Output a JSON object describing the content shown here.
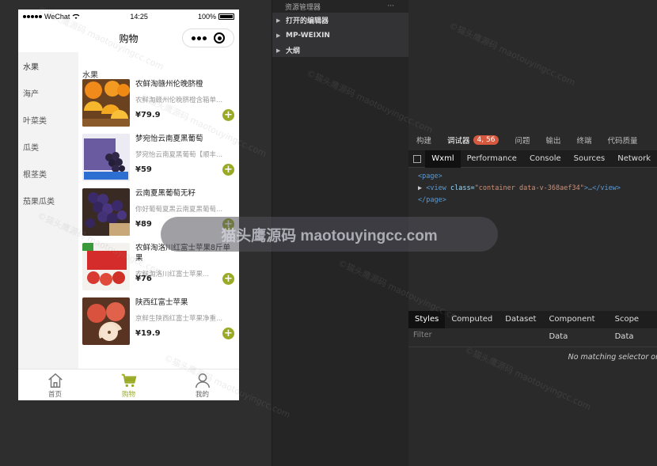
{
  "phone": {
    "status": {
      "carrier": "WeChat",
      "time": "14:25",
      "battery": "100%"
    },
    "title": "购物",
    "categories": [
      "水果",
      "海产",
      "叶菜类",
      "瓜类",
      "根茎类",
      "茄果瓜类"
    ],
    "section_title": "水果",
    "products": [
      {
        "name": "农鲜淘赣州伦晚脐橙",
        "desc": "农鲜淘赣州伦晚脐橙含箱单...",
        "price": "¥79.9"
      },
      {
        "name": "梦宛怡云南夏黑葡萄",
        "desc": "梦宛怡云南夏黑葡萄【顺丰...",
        "price": "¥59"
      },
      {
        "name": "云南夏黑葡萄无籽",
        "desc": "你好葡萄夏黑云南夏黑葡萄...",
        "price": "¥89"
      },
      {
        "name": "农鲜淘洛川红富士苹果8斤单果",
        "desc": "农鲜淘洛川红富士苹果...",
        "price": "¥76"
      },
      {
        "name": "陕西红富士苹果",
        "desc": "京鲜生陕西红富士苹果净重...",
        "price": "¥19.9"
      }
    ],
    "tabs": [
      "首页",
      "购物",
      "我的"
    ],
    "accent": "#9aaa26"
  },
  "middle": {
    "header": "资源管理器",
    "more": "···",
    "items": [
      "打开的编辑器",
      "MP-WEIXIN",
      "大纲"
    ]
  },
  "devtools": {
    "top_tabs": [
      "构建",
      "调试器",
      "问题",
      "输出",
      "终端",
      "代码质量"
    ],
    "badge": "4, 56",
    "sub_tabs": [
      "Wxml",
      "Performance",
      "Console",
      "Sources",
      "Network"
    ],
    "code": {
      "line1": "<page>",
      "line2_tag_open": "<view ",
      "line2_attr": "class=",
      "line2_val": "\"container data-v-368aef34\"",
      "line2_rest": ">…</view>",
      "line3": "</page>"
    },
    "style_tabs": [
      "Styles",
      "Computed",
      "Dataset",
      "Component Data",
      "Scope Data"
    ],
    "filter": "Filter",
    "no_match": "No matching selector or"
  },
  "watermark": {
    "banner": "猫头鹰源码 maotouyingcc.com",
    "small": "©猫头鹰源码 maotouyingcc.com"
  }
}
